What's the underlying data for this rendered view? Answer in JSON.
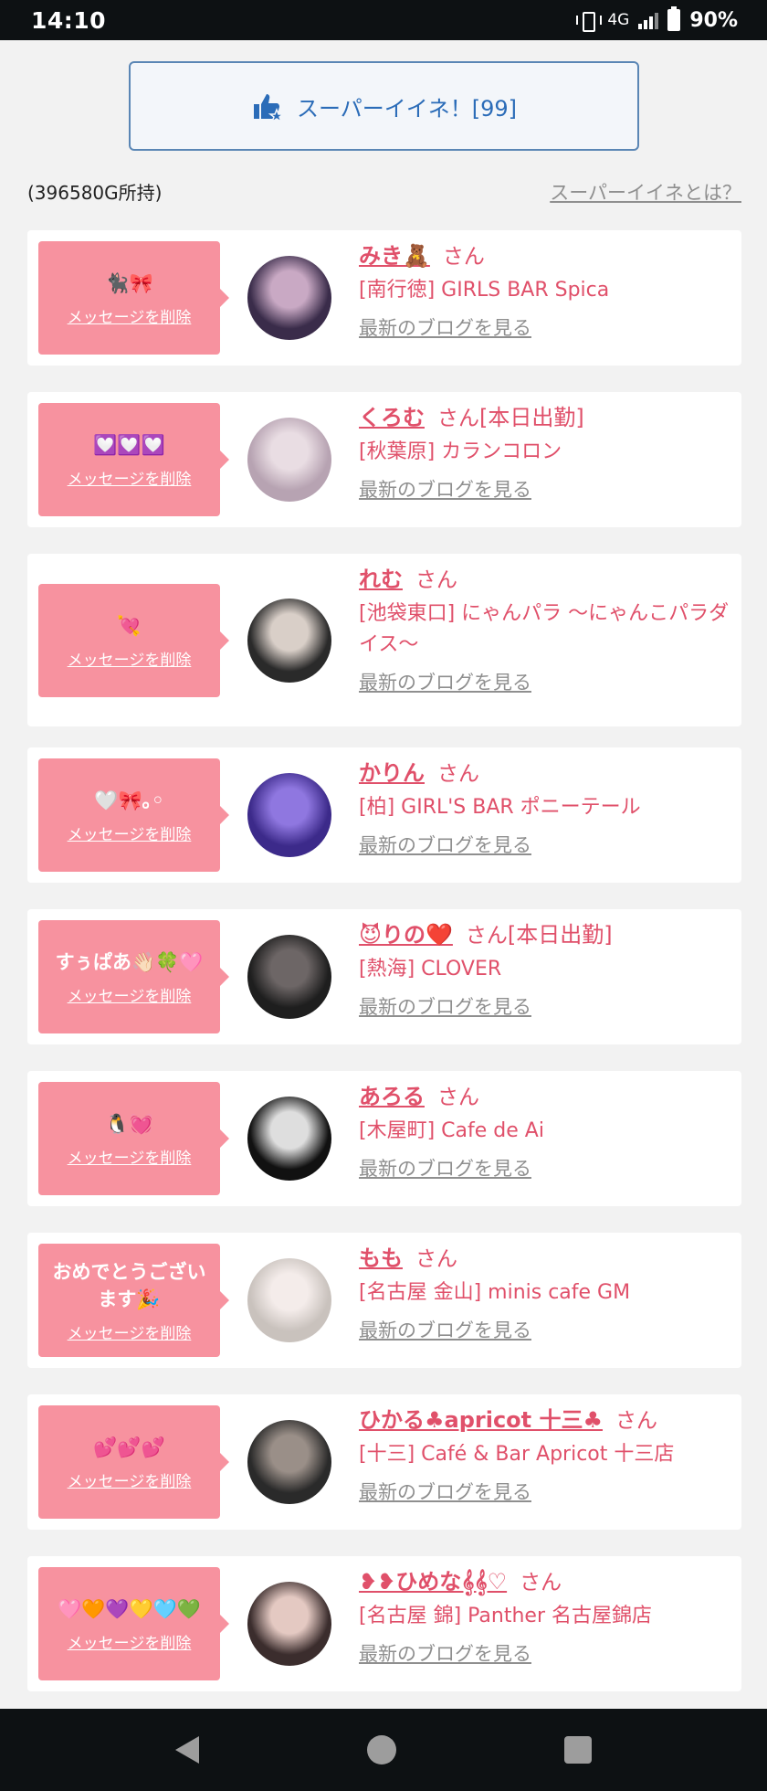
{
  "status": {
    "time": "14:10",
    "network": "4G",
    "battery": "90%"
  },
  "super_iine": {
    "label": "スーパーイイネ！[99]"
  },
  "gold": "(396580G所持)",
  "about_link": "スーパーイイネとは？",
  "delete_label": "メッセージを削除",
  "blog_label": "最新のブログを見る",
  "san_label": "さん",
  "cards": [
    {
      "message": "🐈‍⬛🎀",
      "name": "みき🧸",
      "suffix": "",
      "shop": "[南行徳] GIRLS BAR Spica",
      "avatar_colors": [
        "#3a2c4a",
        "#c9a9c4"
      ]
    },
    {
      "message": "💟💟💟",
      "name": "くろむ",
      "suffix": "[本日出勤]",
      "shop": "[秋葉原] カランコロン",
      "avatar_colors": [
        "#b7a3b2",
        "#e9dde3"
      ]
    },
    {
      "message": "💘",
      "name": "れむ",
      "suffix": "",
      "shop": "[池袋東口] にゃんパラ 〜にゃんこパラダイス〜",
      "avatar_colors": [
        "#2a2a2a",
        "#d9cfc8"
      ]
    },
    {
      "message": "🤍🎀｡◦",
      "name": "かりん",
      "suffix": "",
      "shop": "[柏] GIRL'S BAR ポニーテール",
      "avatar_colors": [
        "#3c2a8a",
        "#8f77e0"
      ]
    },
    {
      "message": "すぅぱあ👋🏻🍀🩷",
      "name": "😈りの❤️",
      "suffix": "[本日出勤]",
      "shop": "[熱海] CLOVER",
      "avatar_colors": [
        "#1e1e1e",
        "#6d6666"
      ]
    },
    {
      "message": "🐧💓",
      "name": "あろる",
      "suffix": "",
      "shop": "[木屋町] Cafe de Ai",
      "avatar_colors": [
        "#111111",
        "#dedede"
      ]
    },
    {
      "message": "おめでとうございます🎉",
      "name": "もも",
      "suffix": "",
      "shop": "[名古屋 金山] minis cafe GM",
      "avatar_colors": [
        "#c9c2bd",
        "#f4ecea"
      ]
    },
    {
      "message": "💕💕💕",
      "name": "ひかる♣apricot 十三♣",
      "suffix": "",
      "shop": "[十三] Café & Bar Apricot 十三店",
      "avatar_colors": [
        "#2a2a2a",
        "#9a8f88"
      ]
    },
    {
      "message": "🩷🧡💜💛🩵💚",
      "name": "❥❥ひめな𝄞𝄞♡",
      "suffix": "",
      "shop": "[名古屋 錦] Panther 名古屋錦店",
      "avatar_colors": [
        "#3b2d2d",
        "#e4c9c2"
      ]
    }
  ]
}
